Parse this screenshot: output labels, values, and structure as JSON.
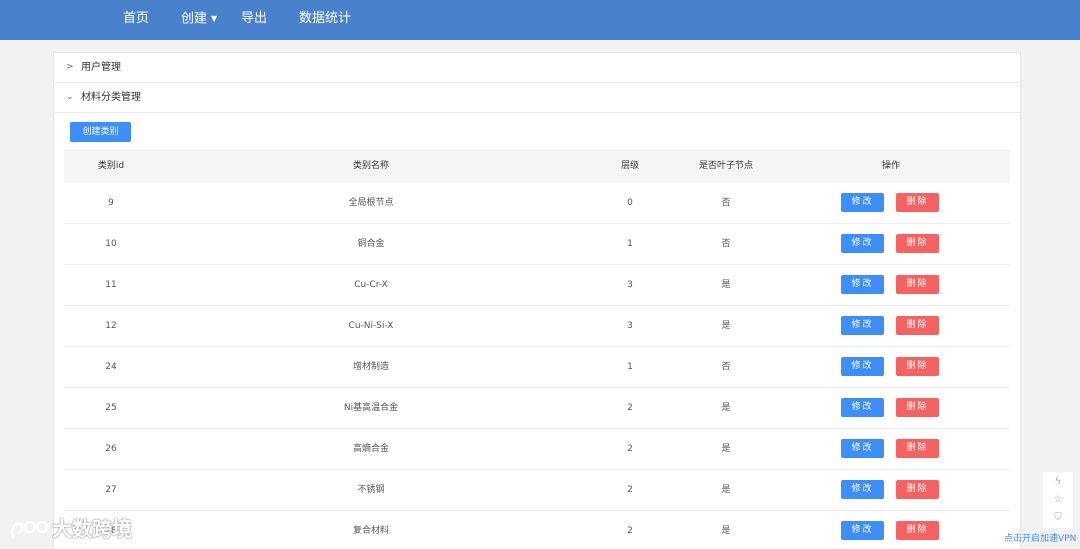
{
  "nav": {
    "home": "首页",
    "create": "创建",
    "export": "导出",
    "stats": "数据统计"
  },
  "panels": {
    "user_mgmt": "用户管理",
    "material_mgmt": "材料分类管理"
  },
  "create_button": "创建类别",
  "table": {
    "headers": {
      "id": "类别id",
      "name": "类别名称",
      "level": "层级",
      "is_leaf": "是否叶子节点",
      "actions": "操作"
    },
    "edit_label": "修改",
    "delete_label": "删除",
    "rows": [
      {
        "id": "9",
        "name": "全局根节点",
        "level": "0",
        "is_leaf": "否"
      },
      {
        "id": "10",
        "name": "铜合金",
        "level": "1",
        "is_leaf": "否"
      },
      {
        "id": "11",
        "name": "Cu-Cr-X",
        "level": "3",
        "is_leaf": "是"
      },
      {
        "id": "12",
        "name": "Cu-Ni-Si-X",
        "level": "3",
        "is_leaf": "是"
      },
      {
        "id": "24",
        "name": "增材制造",
        "level": "1",
        "is_leaf": "否"
      },
      {
        "id": "25",
        "name": "Ni基高温合金",
        "level": "2",
        "is_leaf": "是"
      },
      {
        "id": "26",
        "name": "高熵合金",
        "level": "2",
        "is_leaf": "是"
      },
      {
        "id": "27",
        "name": "不锈钢",
        "level": "2",
        "is_leaf": "是"
      },
      {
        "id": "28",
        "name": "复合材料",
        "level": "2",
        "is_leaf": "是"
      }
    ]
  },
  "watermark": "大数跨境",
  "vpn_link": "点击开启加速VPN",
  "colors": {
    "nav_bg": "#4a81cd",
    "primary": "#3e8ef7",
    "danger": "#f56262"
  }
}
